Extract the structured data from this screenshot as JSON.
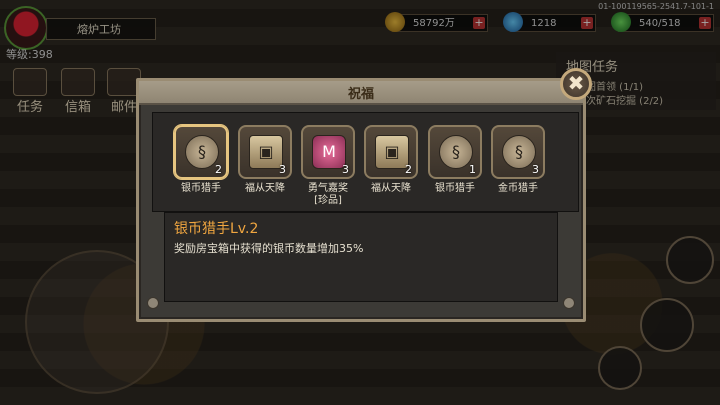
{
  "hud": {
    "level": "等级:398",
    "location": "熔炉工坊",
    "gold": "58792万",
    "gems": "1218",
    "energy": "540/518",
    "version": "01-100119565-2541.7-101-1"
  },
  "side_menu": [
    "任务",
    "信箱",
    "邮件"
  ],
  "quest": {
    "title": "地图任务",
    "items": [
      "图首领 (1/1)",
      "次矿石挖掘 (2/2)"
    ]
  },
  "dialog": {
    "title": "祝福",
    "close_icon": "✖",
    "slots": [
      {
        "label": "银币猎手",
        "count": "2",
        "icon": "coin-icon",
        "selected": true
      },
      {
        "label": "福从天降",
        "count": "3",
        "icon": "chest-icon"
      },
      {
        "label": "勇气嘉奖\n[珍品]",
        "count": "3",
        "icon": "medal-icon"
      },
      {
        "label": "福从天降",
        "count": "2",
        "icon": "chest-icon"
      },
      {
        "label": "银币猎手",
        "count": "1",
        "icon": "coin-icon"
      },
      {
        "label": "金币猎手",
        "count": "3",
        "icon": "coin-icon"
      }
    ],
    "detail": {
      "title": "银币猎手Lv.2",
      "text": "奖励房宝箱中获得的银币数量增加35%"
    }
  }
}
